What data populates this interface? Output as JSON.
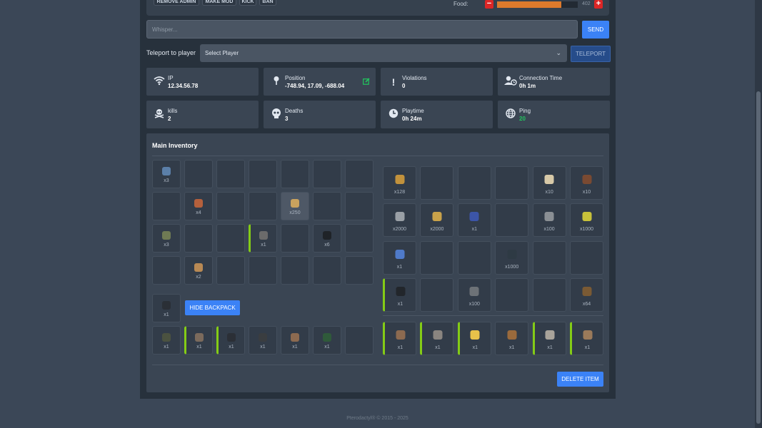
{
  "top_buttons": [
    "REMOVE ADMIN",
    "MAKE MOD",
    "KICK",
    "BAN"
  ],
  "food": {
    "label": "Food:",
    "value": "402",
    "fill_fraction": 0.8,
    "minus": "−",
    "plus": "+"
  },
  "whisper": {
    "placeholder": "Whisper...",
    "send_label": "SEND"
  },
  "teleport": {
    "label": "Teleport to player",
    "select_value": "Select Player",
    "button_label": "TELEPORT"
  },
  "stats": [
    {
      "label": "IP",
      "value": "12.34.56.78",
      "icon": "wifi-icon"
    },
    {
      "label": "Position",
      "value": "-748.94, 17.09, -688.04",
      "icon": "map-pin-icon"
    },
    {
      "label": "Violations",
      "value": "0",
      "icon": "exclamation-icon"
    },
    {
      "label": "Connection Time",
      "value": "0h 1m",
      "icon": "user-clock-icon"
    },
    {
      "label": "kills",
      "value": "2",
      "icon": "skull-crossbones-icon"
    },
    {
      "label": "Deaths",
      "value": "3",
      "icon": "skull-icon"
    },
    {
      "label": "Playtime",
      "value": "0h 24m",
      "icon": "clock-icon"
    },
    {
      "label": "Ping",
      "value": "20",
      "icon": "globe-icon"
    }
  ],
  "colors": {
    "accent": "#3b82f6",
    "danger": "#dc2626",
    "food": "#dd7a2c",
    "equipped": "#84cc16",
    "ping_good": "#22c55e"
  },
  "inventory": {
    "title": "Main Inventory",
    "hide_backpack_label": "HIDE BACKPACK",
    "delete_label": "DELETE ITEM",
    "left_grid": [
      [
        {
          "c": "x3",
          "col": "#5b7fa8"
        },
        {
          "c": ""
        },
        {
          "c": ""
        },
        {
          "c": ""
        },
        {
          "c": ""
        },
        {
          "c": ""
        },
        {
          "c": ""
        }
      ],
      [
        {
          "c": ""
        },
        {
          "c": "x4",
          "col": "#b5603c"
        },
        {
          "c": ""
        },
        {
          "c": ""
        },
        {
          "c": "x250",
          "col": "#c9a25e",
          "hl": true
        },
        {
          "c": ""
        },
        {
          "c": ""
        }
      ],
      [
        {
          "c": "x3",
          "col": "#6f7a54"
        },
        {
          "c": ""
        },
        {
          "c": ""
        },
        {
          "c": "x1",
          "col": "#6b6b6b",
          "eq": true
        },
        {
          "c": ""
        },
        {
          "c": "x6",
          "col": "#1f2328"
        },
        {
          "c": ""
        }
      ],
      [
        {
          "c": ""
        },
        {
          "c": "x2",
          "col": "#b88954"
        },
        {
          "c": ""
        },
        {
          "c": ""
        },
        {
          "c": ""
        },
        {
          "c": ""
        },
        {
          "c": ""
        }
      ]
    ],
    "backpack": {
      "c": "x1",
      "col": "#2a2f36"
    },
    "equip_row": [
      {
        "c": "x1",
        "col": "#4b5240"
      },
      {
        "c": "x1",
        "col": "#7b6a5c",
        "eq": true
      },
      {
        "c": "x1",
        "col": "#2b2f36",
        "eq": true
      },
      {
        "c": "x1",
        "col": "#3a3d40"
      },
      {
        "c": "x1",
        "col": "#8c6a50"
      },
      {
        "c": "x1",
        "col": "#2f5a3a"
      },
      {
        "c": ""
      }
    ],
    "right_grid": [
      [
        {
          "c": "x128",
          "col": "#c2923c"
        },
        {
          "c": ""
        },
        {
          "c": ""
        },
        {
          "c": ""
        },
        {
          "c": "x10",
          "col": "#d7c9a8"
        },
        {
          "c": "x10",
          "col": "#7a4a32"
        }
      ],
      [
        {
          "c": "x2000",
          "col": "#9aa0a6"
        },
        {
          "c": "x2000",
          "col": "#c9a24a"
        },
        {
          "c": "x1",
          "col": "#3c55a8"
        },
        {
          "c": ""
        },
        {
          "c": "x100",
          "col": "#8a8f94"
        },
        {
          "c": "x1000",
          "col": "#c8c23a"
        }
      ],
      [
        {
          "c": "x1",
          "col": "#4f7ac9"
        },
        {
          "c": ""
        },
        {
          "c": ""
        },
        {
          "c": "x1000",
          "col": "#2e3a44"
        },
        {
          "c": ""
        },
        {
          "c": ""
        }
      ],
      [
        {
          "c": "x1",
          "col": "#22262b",
          "eq": true
        },
        {
          "c": ""
        },
        {
          "c": "x100",
          "col": "#6d7277"
        },
        {
          "c": ""
        },
        {
          "c": ""
        },
        {
          "c": "x64",
          "col": "#7a5a34"
        }
      ]
    ],
    "hotbar": [
      {
        "c": "x1",
        "col": "#8c6a50",
        "eq": true
      },
      {
        "c": "x1",
        "col": "#8a8580",
        "eq": true
      },
      {
        "c": "x1",
        "col": "#e8c24a",
        "eq": true
      },
      {
        "c": "x1",
        "col": "#9a6a3c"
      },
      {
        "c": "x1",
        "col": "#a9a39a",
        "eq": true
      },
      {
        "c": "x1",
        "col": "#9a7a5a",
        "eq": true
      }
    ]
  },
  "footer": "Pterodactyl® © 2015 - 2025"
}
